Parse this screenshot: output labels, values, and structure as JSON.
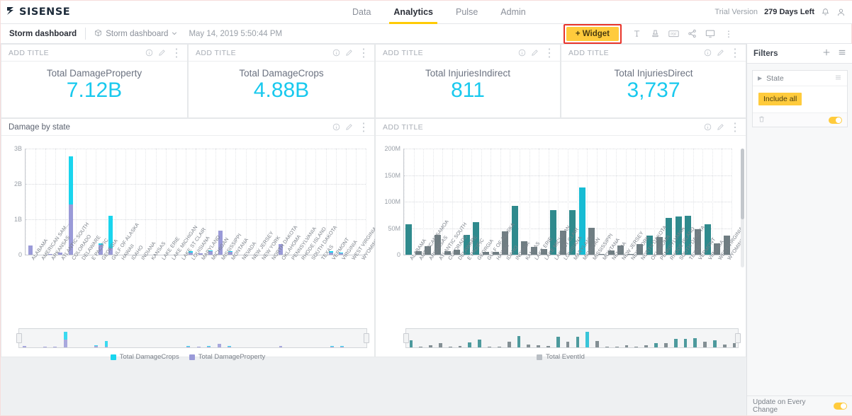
{
  "app": {
    "brand": "SISENSE",
    "brand_icon": "sisense-logo-icon"
  },
  "topnav": {
    "items": [
      {
        "label": "Data",
        "active": false
      },
      {
        "label": "Analytics",
        "active": true
      },
      {
        "label": "Pulse",
        "active": false
      },
      {
        "label": "Admin",
        "active": false
      }
    ],
    "trial_label": "Trial Version",
    "trial_days": "279 Days Left",
    "bell_icon": "bell-icon",
    "user_icon": "user-avatar-icon"
  },
  "dashbar": {
    "title": "Storm dashboard",
    "selector_label": "Storm dashboard",
    "selector_icon": "cube-icon",
    "chevron_icon": "chevron-down-icon",
    "date": "May 14, 2019 5:50:44 PM",
    "toolbar": {
      "add_widget_label": "+ Widget",
      "icons": [
        {
          "name": "text-icon",
          "glyph": "T"
        },
        {
          "name": "stamp-icon",
          "glyph": "stamp"
        },
        {
          "name": "pdf-icon",
          "glyph": "PDF"
        },
        {
          "name": "share-icon",
          "glyph": "share"
        },
        {
          "name": "present-icon",
          "glyph": "monitor"
        },
        {
          "name": "more-options-icon",
          "glyph": "⋮"
        }
      ]
    }
  },
  "widget_actions": {
    "info": "ⓘ",
    "edit": "edit-pencil-icon",
    "menu": "⋮"
  },
  "kpis": [
    {
      "header": "ADD TITLE",
      "label": "Total DamageProperty",
      "value": "7.12B"
    },
    {
      "header": "ADD TITLE",
      "label": "Total DamageCrops",
      "value": "4.88B"
    },
    {
      "header": "ADD TITLE",
      "label": "Total InjuriesIndirect",
      "value": "811"
    },
    {
      "header": "ADD TITLE",
      "label": "Total InjuriesDirect",
      "value": "3,737"
    }
  ],
  "colors": {
    "kpi_value": "#19c9ee",
    "damage_crops": "#19d5ee",
    "damage_property": "#9a9ad8",
    "event_teal": "#2f8a8d",
    "event_gray": "#6f7d82",
    "event_highlight": "#17bcd4",
    "accent_yellow": "#ffcb3c",
    "highlight_outline": "#e8342a"
  },
  "chart_data": [
    {
      "type": "bar",
      "id": "damage-by-state",
      "title": "Damage by state",
      "stacked": true,
      "xlabel": "",
      "ylabel": "",
      "ylim": [
        0,
        3000000000
      ],
      "ytick_labels": [
        "0",
        "1B",
        "2B",
        "3B"
      ],
      "ytick_values": [
        0,
        1000000000,
        2000000000,
        3000000000
      ],
      "grid": true,
      "legend_position": "bottom",
      "has_navigator": true,
      "categories": [
        "ALABAMA",
        "AMERICAN SAM...",
        "ARKANSAS",
        "ATLANTIC SOUTH",
        "COLORADO",
        "DELAWARE",
        "E PACIFIC",
        "GEORGIA",
        "GULF OF ALASKA",
        "HAWAII",
        "IDAHO",
        "INDIANA",
        "KANSAS",
        "LAKE ERIE",
        "LAKE MICHIGAN",
        "LAKE ST CLAIR",
        "LOUISIANA",
        "MARYLAND",
        "MICHIGAN",
        "MISSISSIPPI",
        "MONTANA",
        "NEVADA",
        "NEW JERSEY",
        "NEW YORK",
        "NORTH DAKOTA",
        "OKLAHOMA",
        "PENNSYLVANIA",
        "RHODE ISLAND",
        "SOUTH DAKOTA",
        "TEXAS",
        "VERMONT",
        "VIRGINIA",
        "WEST VIRGINIA",
        "WYOMING"
      ],
      "series": [
        {
          "name": "Total DamageProperty",
          "color": "#9a9ad8",
          "values": [
            270000000,
            0,
            20000000,
            55000000,
            1430000000,
            0,
            0,
            290000000,
            190000000,
            0,
            0,
            0,
            0,
            0,
            0,
            0,
            70000000,
            35000000,
            100000000,
            690000000,
            80000000,
            0,
            0,
            0,
            0,
            300000000,
            0,
            0,
            0,
            0,
            70000000,
            50000000,
            0,
            0
          ]
        },
        {
          "name": "Total DamageCrops",
          "color": "#19d5ee",
          "values": [
            0,
            0,
            0,
            0,
            1360000000,
            0,
            0,
            30000000,
            920000000,
            0,
            0,
            0,
            0,
            0,
            0,
            0,
            30000000,
            0,
            25000000,
            0,
            20000000,
            0,
            0,
            0,
            0,
            0,
            0,
            0,
            0,
            0,
            30000000,
            20000000,
            0,
            0
          ]
        }
      ],
      "legend": [
        {
          "name": "Total DamageCrops",
          "color": "#19d5ee"
        },
        {
          "name": "Total DamageProperty",
          "color": "#9a9ad8"
        }
      ]
    },
    {
      "type": "bar",
      "id": "total-eventid-by-state",
      "title": "ADD TITLE",
      "stacked": false,
      "xlabel": "",
      "ylabel": "",
      "ylim": [
        0,
        200000000
      ],
      "ytick_labels": [
        "0",
        "50M",
        "100M",
        "150M",
        "200M"
      ],
      "ytick_values": [
        0,
        50000000,
        100000000,
        150000000,
        200000000
      ],
      "grid": true,
      "legend_position": "bottom",
      "has_navigator": true,
      "categories": [
        "ALABAMA",
        "AMERICAN SAMOA",
        "ARKANSAS",
        "ATLANTIC SOUTH",
        "COLORADO",
        "DELAWARE",
        "E PACIFIC",
        "GEORGIA",
        "GULF OF ALASKA",
        "HAWAII",
        "IDAHO",
        "INDIANA",
        "KANSAS",
        "LAKE ERIE",
        "LAKE MICHIGAN",
        "LAKE ST CLAIR",
        "LOUISIANA",
        "MARYLAND",
        "MICHIGAN",
        "MISSISSIPPI",
        "MONTANA",
        "NEVADA",
        "NEW JERSEY",
        "NEW YORK",
        "NORTH DAKOTA",
        "OKLAHOMA",
        "PENNSYLVANIA",
        "RHODE ISLAND",
        "SOUTH DAKOTA",
        "TEXAS",
        "VERMONT",
        "VIRGINIA",
        "WEST VIRGINIA",
        "WYOMING"
      ],
      "series": [
        {
          "name": "Total EventId",
          "values": [
            57000000,
            7000000,
            16000000,
            37000000,
            7000000,
            9000000,
            38000000,
            62000000,
            5000000,
            6000000,
            44000000,
            92000000,
            25000000,
            15000000,
            11000000,
            84000000,
            45000000,
            84000000,
            127000000,
            51000000,
            2000000,
            8000000,
            17000000,
            1000000,
            20000000,
            36000000,
            33000000,
            70000000,
            72000000,
            74000000,
            48000000,
            57000000,
            21000000,
            36000000
          ],
          "colors": [
            "#2f8a8d",
            "#6f7d82",
            "#6f7d82",
            "#6f7d82",
            "#6f7d82",
            "#6f7d82",
            "#2f8a8d",
            "#2f8a8d",
            "#6f7d82",
            "#6f7d82",
            "#6f7d82",
            "#2f8a8d",
            "#6f7d82",
            "#6f7d82",
            "#6f7d82",
            "#2f8a8d",
            "#6f7d82",
            "#2f8a8d",
            "#17bcd4",
            "#6f7d82",
            "#6f7d82",
            "#6f7d82",
            "#6f7d82",
            "#6f7d82",
            "#6f7d82",
            "#2f8a8d",
            "#6f7d82",
            "#2f8a8d",
            "#2f8a8d",
            "#2f8a8d",
            "#6f7d82",
            "#2f8a8d",
            "#6f7d82",
            "#6f7d82"
          ]
        }
      ],
      "legend": [
        {
          "name": "Total EventId",
          "color": "#b9bec4"
        }
      ]
    }
  ],
  "filters": {
    "title": "Filters",
    "add_icon": "plus-icon",
    "menu_icon": "hamburger-menu-icon",
    "items": [
      {
        "name": "State",
        "expand_icon": "chevron-right-icon",
        "list_icon": "list-icon",
        "chip": "Include all",
        "delete_icon": "trash-icon",
        "enabled": true
      }
    ],
    "footer_label": "Update on Every Change",
    "footer_enabled": true
  }
}
